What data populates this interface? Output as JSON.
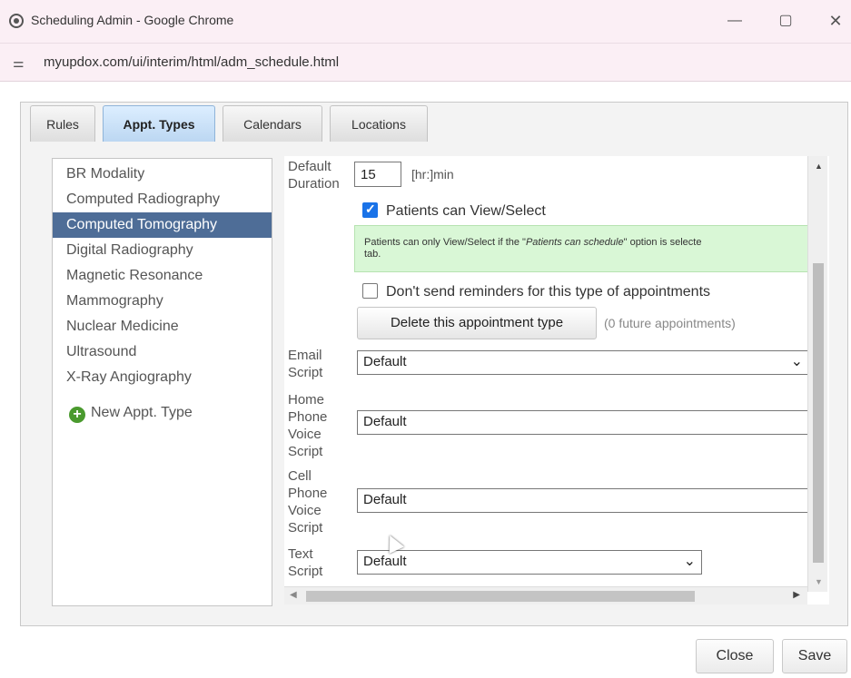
{
  "window": {
    "title": "Scheduling Admin - Google Chrome",
    "minimize_icon": "minimize-icon",
    "maximize_icon": "maximize-icon",
    "close_icon": "close-icon"
  },
  "address_bar": {
    "url": "myupdox.com/ui/interim/html/adm_schedule.html",
    "site_info_icon": "tune-icon"
  },
  "tabs": [
    {
      "label": "Rules",
      "active": false
    },
    {
      "label": "Appt. Types",
      "active": true
    },
    {
      "label": "Calendars",
      "active": false
    },
    {
      "label": "Locations",
      "active": false
    }
  ],
  "appt_types": [
    {
      "label": "BR Modality",
      "selected": false
    },
    {
      "label": "Computed Radiography",
      "selected": false
    },
    {
      "label": "Computed Tomography",
      "selected": true
    },
    {
      "label": "Digital Radiography",
      "selected": false
    },
    {
      "label": "Magnetic Resonance",
      "selected": false
    },
    {
      "label": "Mammography",
      "selected": false
    },
    {
      "label": "Nuclear Medicine",
      "selected": false
    },
    {
      "label": "Ultrasound",
      "selected": false
    },
    {
      "label": "X-Ray Angiography",
      "selected": false
    }
  ],
  "new_appt_type_label": "New Appt. Type",
  "form": {
    "default_duration_label_1": "Default",
    "default_duration_label_2": "Duration",
    "default_duration_value": "15",
    "duration_unit": "[hr:]min",
    "patients_can_view_label": "Patients can View/Select",
    "patients_can_view_checked": true,
    "notice_text_1": "Patients can only View/Select if the \"",
    "notice_text_em": "Patients can schedule",
    "notice_text_2": "\" option is selecte",
    "notice_text_3": "tab.",
    "no_reminders_label": "Don't send reminders for this type of appointments",
    "no_reminders_checked": false,
    "delete_button": "Delete this appointment type",
    "future_appointments": "(0 future appointments)",
    "email_script_label_1": "Email",
    "email_script_label_2": "Script",
    "email_script_value": "Default",
    "home_phone_label_1": "Home",
    "home_phone_label_2": "Phone",
    "home_phone_label_3": "Voice",
    "home_phone_label_4": "Script",
    "home_phone_value": "Default",
    "cell_phone_label_1": "Cell",
    "cell_phone_label_2": "Phone",
    "cell_phone_label_3": "Voice",
    "cell_phone_label_4": "Script",
    "cell_phone_value": "Default",
    "text_script_label_1": "Text",
    "text_script_label_2": "Script",
    "text_script_value": "Default"
  },
  "footer": {
    "close_button": "Close",
    "save_button": "Save"
  }
}
